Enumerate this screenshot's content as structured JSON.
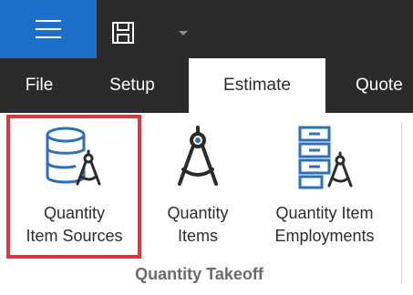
{
  "quick_access": {
    "menu_icon": "hamburger-menu-icon",
    "save_icon": "save-icon",
    "dropdown_icon": "chevron-down-icon"
  },
  "tabs": [
    {
      "label": "File"
    },
    {
      "label": "Setup"
    },
    {
      "label": "Estimate"
    },
    {
      "label": "Quote"
    }
  ],
  "ribbon": {
    "group_label": "Quantity Takeoff",
    "buttons": [
      {
        "line1": "Quantity",
        "line2": "Item Sources",
        "icon": "database-compass-icon"
      },
      {
        "line1": "Quantity",
        "line2": "Items",
        "icon": "compass-icon"
      },
      {
        "line1": "Quantity Item",
        "line2": "Employments",
        "icon": "drawers-compass-icon"
      }
    ]
  },
  "colors": {
    "accent": "#1e6fc9",
    "highlight": "#e0353d",
    "icon_blue": "#2f6fb5"
  }
}
